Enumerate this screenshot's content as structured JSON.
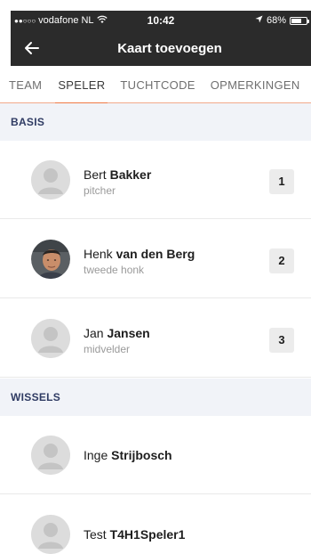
{
  "status_bar": {
    "carrier": "vodafone NL",
    "time": "10:42",
    "battery": "68%",
    "battery_level": 0.68,
    "icons": [
      "signal-dots-icon",
      "wifi-icon",
      "location-arrow-icon",
      "battery-icon"
    ]
  },
  "header": {
    "title": "Kaart toevoegen",
    "back_icon": "back-arrow-icon"
  },
  "tabs": [
    {
      "label": "TEAM",
      "active": false
    },
    {
      "label": "SPELER",
      "active": true
    },
    {
      "label": "TUCHTCODE",
      "active": false
    },
    {
      "label": "OPMERKINGEN",
      "active": false
    }
  ],
  "colors": {
    "header_bg": "#2b2b2b",
    "accent": "#f07a46",
    "section_bg": "#f1f3f8",
    "section_text": "#2f3b63"
  },
  "sections": {
    "basis": {
      "title": "BASIS",
      "players": [
        {
          "first": "Bert",
          "last": "Bakker",
          "role": "pitcher",
          "number": "1",
          "avatar": "placeholder-avatar-icon"
        },
        {
          "first": "Henk",
          "last": "van den Berg",
          "role": "tweede honk",
          "number": "2",
          "avatar": "photo-avatar"
        },
        {
          "first": "Jan",
          "last": "Jansen",
          "role": "midvelder",
          "number": "3",
          "avatar": "placeholder-avatar-icon"
        }
      ]
    },
    "wissels": {
      "title": "WISSELS",
      "players": [
        {
          "first": "Inge",
          "last": "Strijbosch",
          "avatar": "placeholder-avatar-icon"
        },
        {
          "first": "Test",
          "last": "T4H1Speler1",
          "avatar": "placeholder-avatar-icon"
        }
      ]
    }
  }
}
